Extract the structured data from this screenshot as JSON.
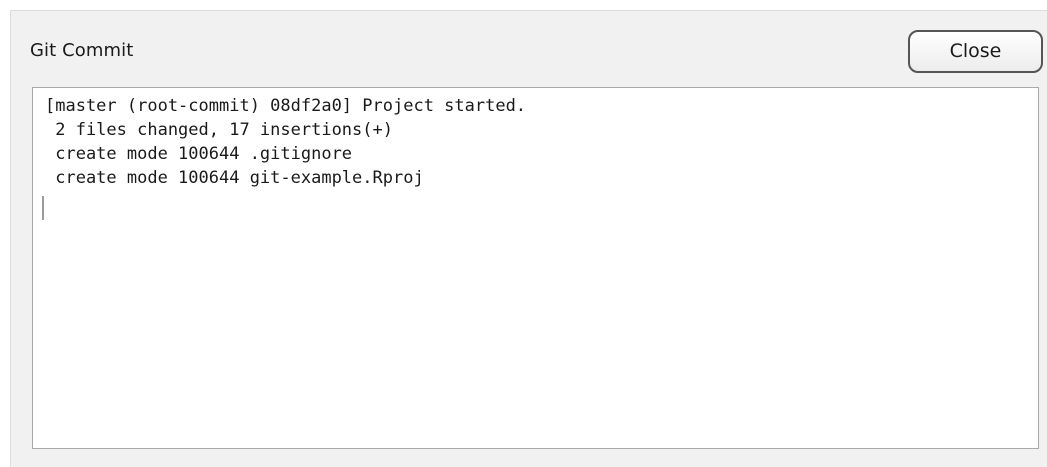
{
  "dialog": {
    "title": "Git Commit",
    "close_label": "Close"
  },
  "console": {
    "lines": [
      "[master (root-commit) 08df2a0] Project started.",
      " 2 files changed, 17 insertions(+)",
      " create mode 100644 .gitignore",
      " create mode 100644 git-example.Rproj"
    ]
  },
  "colors": {
    "dialog_background": "#f1f1f1",
    "console_background": "#ffffff",
    "text": "#1a1a1a",
    "button_border": "#555555"
  }
}
